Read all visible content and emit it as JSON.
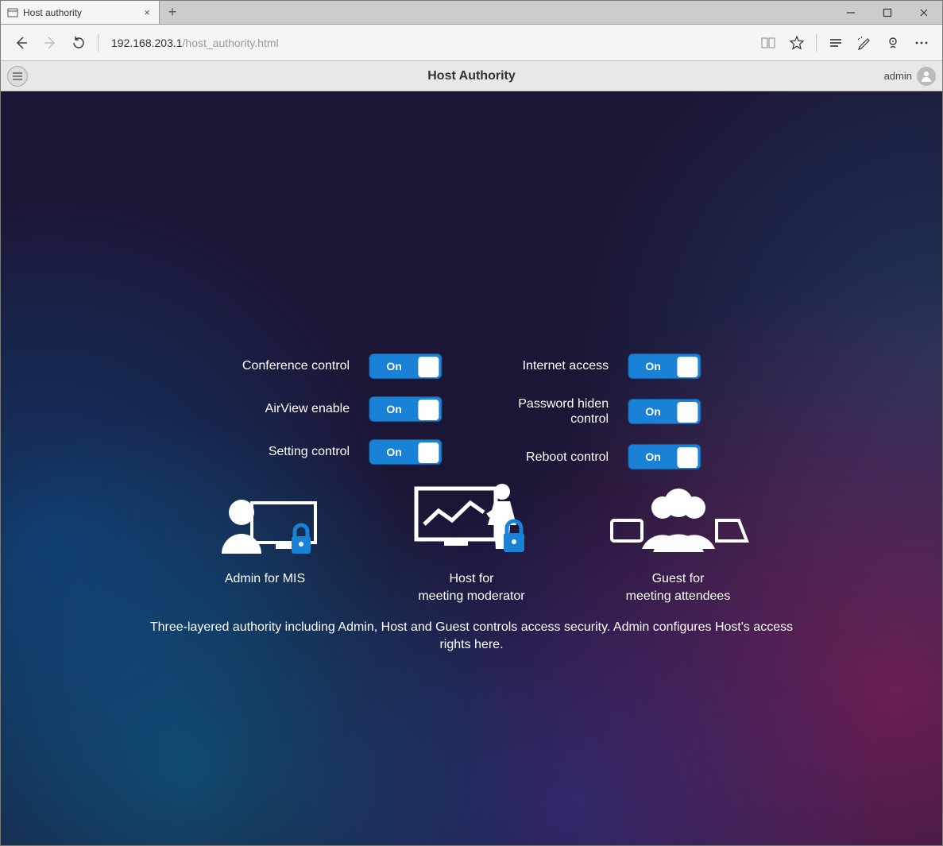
{
  "browser": {
    "tab_title": "Host authority",
    "url_host": "192.168.203.1",
    "url_path": "/host_authority.html"
  },
  "app": {
    "title": "Host Authority",
    "user": "admin"
  },
  "toggles": {
    "left": [
      {
        "label": "Conference control",
        "state": "On"
      },
      {
        "label": "AirView enable",
        "state": "On"
      },
      {
        "label": "Setting control",
        "state": "On"
      }
    ],
    "right": [
      {
        "label": "Internet access",
        "state": "On"
      },
      {
        "label": "Password hiden control",
        "state": "On"
      },
      {
        "label": "Reboot control",
        "state": "On"
      }
    ]
  },
  "roles": [
    {
      "line1": "Admin for MIS",
      "line2": ""
    },
    {
      "line1": "Host for",
      "line2": "meeting moderator"
    },
    {
      "line1": "Guest for",
      "line2": "meeting attendees"
    }
  ],
  "footnote": "Three-layered authority including Admin, Host and Guest controls access security. Admin configures Host's access rights here."
}
